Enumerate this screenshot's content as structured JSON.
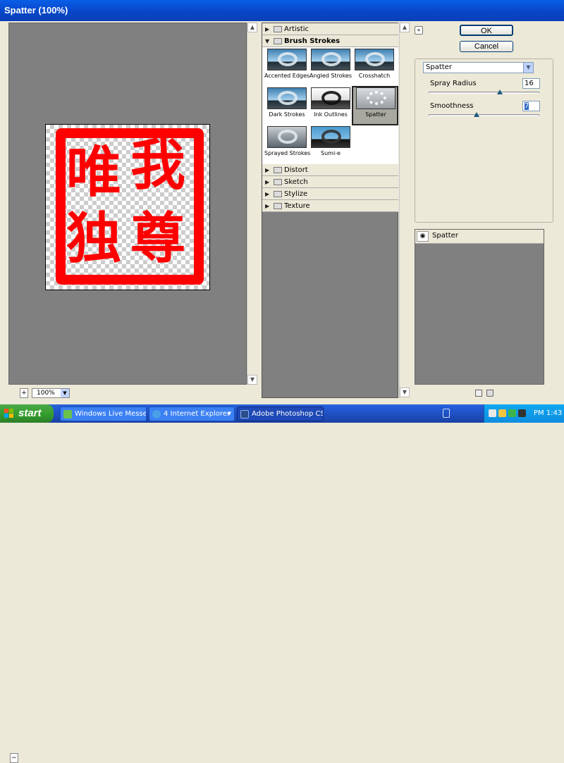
{
  "window": {
    "title": "Spatter (100%)"
  },
  "preview": {
    "glyphs": [
      "唯",
      "我",
      "独",
      "尊"
    ],
    "zoom_minus": "−",
    "zoom_plus": "+",
    "zoom_value": "100%"
  },
  "gallery": {
    "categories_top": [
      {
        "label": "Artistic",
        "expanded": false
      },
      {
        "label": "Brush Strokes",
        "expanded": true
      }
    ],
    "filters": [
      {
        "label": "Accented Edges"
      },
      {
        "label": "Angled Strokes"
      },
      {
        "label": "Crosshatch"
      },
      {
        "label": "Dark Strokes"
      },
      {
        "label": "Ink Outlines"
      },
      {
        "label": "Spatter",
        "selected": true
      },
      {
        "label": "Sprayed Strokes"
      },
      {
        "label": "Sumi-e"
      }
    ],
    "categories_bottom": [
      {
        "label": "Distort"
      },
      {
        "label": "Sketch"
      },
      {
        "label": "Stylize"
      },
      {
        "label": "Texture"
      }
    ]
  },
  "dialog": {
    "ok_label": "OK",
    "cancel_label": "Cancel",
    "filter_select": "Spatter",
    "params": [
      {
        "label": "Spray Radius",
        "value": "16",
        "level": 0.64
      },
      {
        "label": "Smoothness",
        "value": "7",
        "level": 0.47
      }
    ]
  },
  "layers": {
    "items": [
      {
        "label": "Spatter",
        "visible": true
      }
    ]
  },
  "taskbar": {
    "start_label": "start",
    "tasks": [
      {
        "label": "Windows Live Messen..."
      },
      {
        "label": "4 Internet Explorer"
      },
      {
        "label": "Adobe Photoshop CS..."
      }
    ],
    "clock": "PM 1:43"
  },
  "colors": {
    "stamp_red": "#ff0000",
    "titlebar_blue": "#0a5ee8",
    "start_green": "#329b2c"
  }
}
